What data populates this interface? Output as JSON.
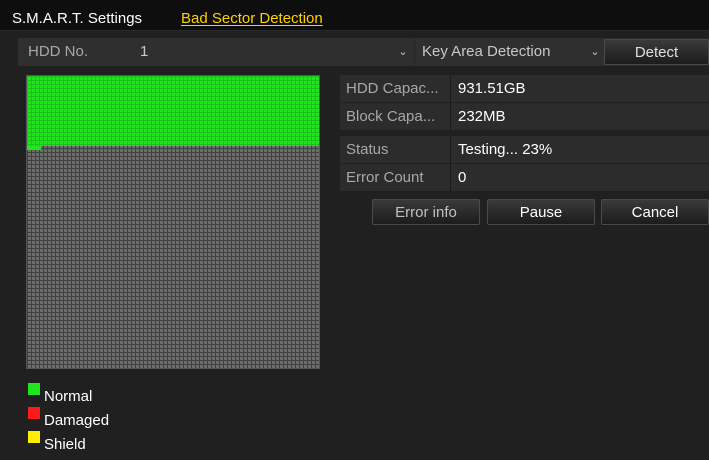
{
  "tabs": {
    "smart_label": "S.M.A.R.T. Settings",
    "bad_sector_label": "Bad Sector Detection"
  },
  "hdd": {
    "label": "HDD No.",
    "value": "1",
    "mode": "Key Area Detection",
    "chevron": "⌄",
    "detect_label": "Detect"
  },
  "info": {
    "capacity_key": "HDD Capac...",
    "capacity_value": "931.51GB",
    "block_key": "Block Capa...",
    "block_value": "232MB",
    "status_key": "Status",
    "status_value": "Testing... 23%",
    "error_key": "Error Count",
    "error_value": "0"
  },
  "actions": {
    "error_info_label": "Error info",
    "pause_label": "Pause",
    "cancel_label": "Cancel"
  },
  "progress": {
    "fraction": 0.23
  },
  "legend": [
    {
      "label": "Normal",
      "color": "#1fe51f"
    },
    {
      "label": "Damaged",
      "color": "#ff1a1a"
    },
    {
      "label": "Shield",
      "color": "#ffee00"
    }
  ],
  "colors": {
    "normal": "#1fe51f",
    "active_tab": "#ffd200"
  }
}
